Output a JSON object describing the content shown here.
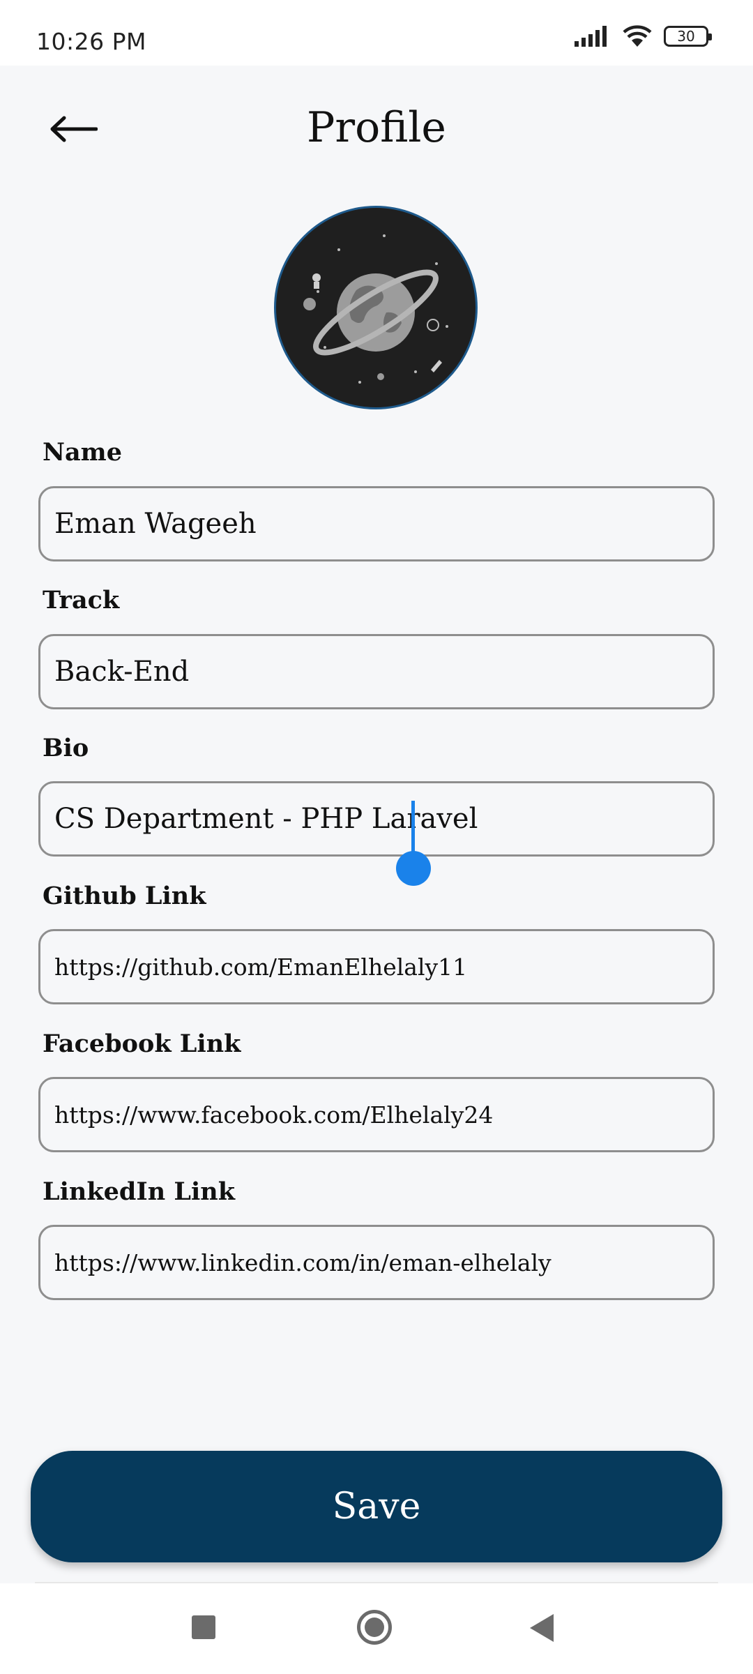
{
  "status_bar": {
    "time": "10:26 PM",
    "battery": "30",
    "icons": [
      "signal-icon",
      "wifi-icon",
      "battery-icon"
    ]
  },
  "header": {
    "title": "Profile",
    "back_icon": "arrow-left-icon"
  },
  "avatar": {
    "icon": "planet-illustration"
  },
  "form": {
    "name": {
      "label": "Name",
      "value": "Eman Wageeh"
    },
    "track": {
      "label": "Track",
      "value": "Back-End"
    },
    "bio": {
      "label": "Bio",
      "value": "CS Department - PHP Laravel"
    },
    "github": {
      "label": "Github Link",
      "value": "https://github.com/EmanElhelaly11"
    },
    "facebook": {
      "label": "Facebook Link",
      "value": "https://www.facebook.com/Elhelaly24"
    },
    "linkedin": {
      "label": "LinkedIn Link",
      "value": "https://www.linkedin.com/in/eman-elhelaly"
    }
  },
  "save_button": {
    "label": "Save"
  },
  "colors": {
    "primary": "#063a5c",
    "cursor": "#1a82ea",
    "background": "#f6f7f9",
    "field_border": "#8e8e8e"
  }
}
